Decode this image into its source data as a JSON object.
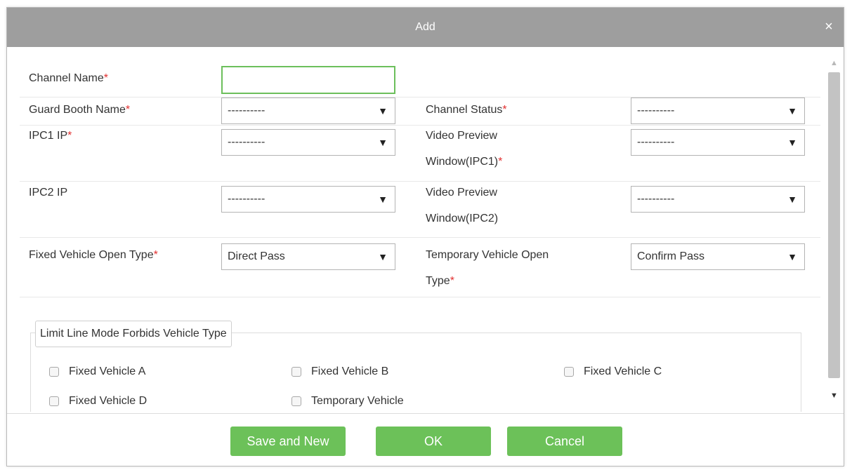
{
  "dialog": {
    "title": "Add",
    "close_icon": "×"
  },
  "form": {
    "channel_name": {
      "label": "Channel Name",
      "required": "*",
      "value": ""
    },
    "guard_booth_name": {
      "label": "Guard Booth Name",
      "required": "*",
      "value": "----------"
    },
    "channel_status": {
      "label": "Channel Status",
      "required": "*",
      "value": "----------"
    },
    "ipc1_ip": {
      "label": "IPC1 IP",
      "required": "*",
      "value": "----------"
    },
    "video_preview_ipc1": {
      "label_line1": "Video Preview",
      "label_line2": "Window(IPC1)",
      "required": "*",
      "value": "----------"
    },
    "ipc2_ip": {
      "label": "IPC2 IP",
      "value": "----------"
    },
    "video_preview_ipc2": {
      "label_line1": "Video Preview",
      "label_line2": "Window(IPC2)",
      "value": "----------"
    },
    "fixed_vehicle_open_type": {
      "label": "Fixed Vehicle Open Type",
      "required": "*",
      "value": "Direct Pass"
    },
    "temporary_vehicle_open_type": {
      "label_line1": "Temporary Vehicle Open",
      "label_line2": "Type",
      "required": "*",
      "value": "Confirm Pass"
    },
    "dropdown_arrow": "▼"
  },
  "limit_line": {
    "legend": "Limit Line Mode Forbids Vehicle Type",
    "options": [
      "Fixed Vehicle A",
      "Fixed Vehicle B",
      "Fixed Vehicle C",
      "Fixed Vehicle D",
      "Temporary Vehicle"
    ]
  },
  "scrollbar": {
    "up_icon": "▲",
    "down_icon": "▼"
  },
  "buttons": {
    "save_and_new": "Save and New",
    "ok": "OK",
    "cancel": "Cancel"
  },
  "colors": {
    "title_bar": "#9e9e9e",
    "button_green": "#6cc159",
    "required_red": "#e23030",
    "focus_border": "#6cbf5b"
  }
}
